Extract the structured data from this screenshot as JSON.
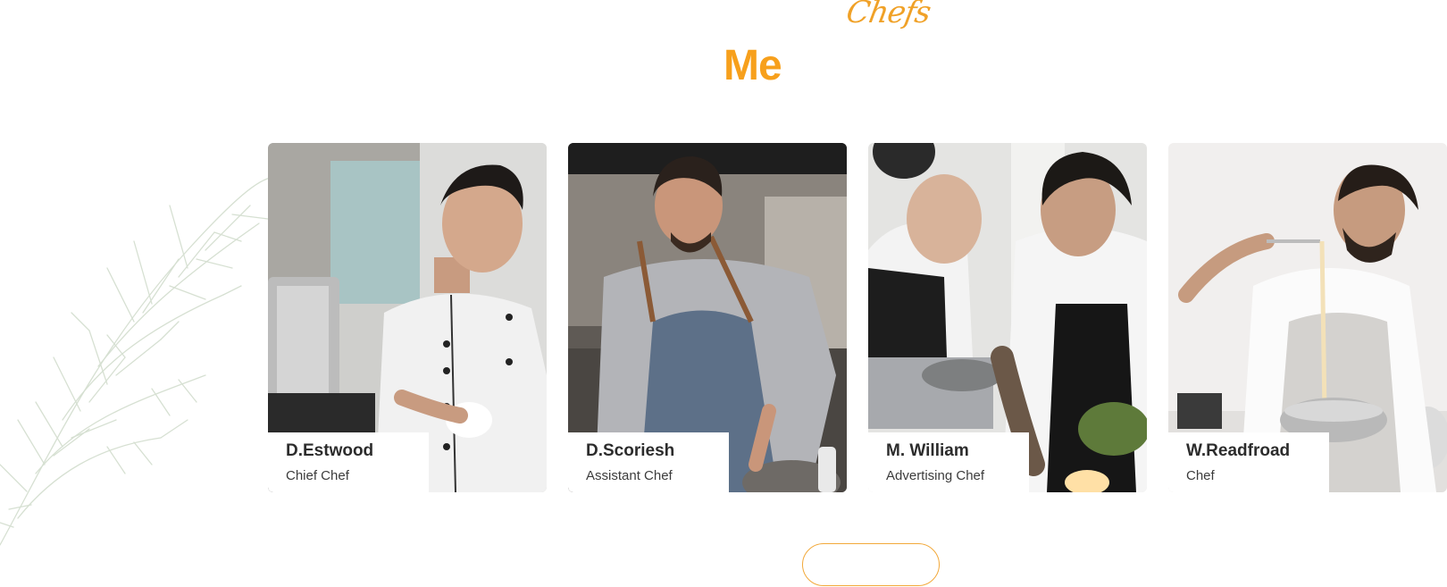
{
  "section": {
    "script_title": "Chefs",
    "title": "Me"
  },
  "chefs": [
    {
      "name": "D.Estwood",
      "role": "Chief Chef"
    },
    {
      "name": "D.Scoriesh",
      "role": "Assistant Chef"
    },
    {
      "name": "M. William",
      "role": "Advertising Chef"
    },
    {
      "name": "W.Readfroad",
      "role": "Chef"
    }
  ],
  "more_button": {
    "label": ""
  },
  "colors": {
    "accent": "#f7a01c",
    "text": "#2c2c2c",
    "background": "#ffffff"
  }
}
